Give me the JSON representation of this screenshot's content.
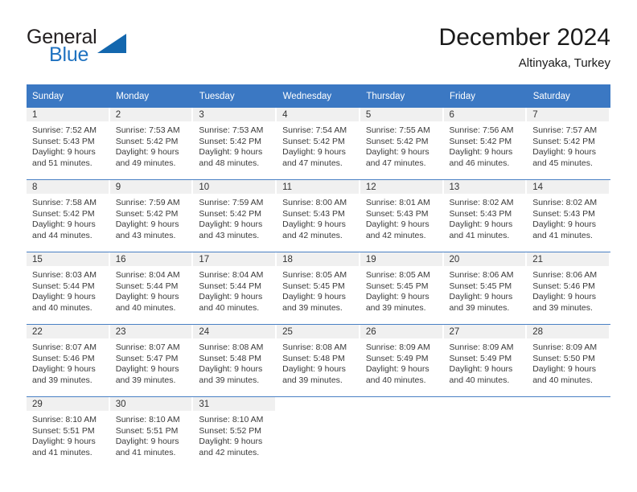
{
  "brand": {
    "name_part1": "General",
    "name_part2": "Blue",
    "triangle_color": "#1367ae",
    "blue_color": "#1f72c0"
  },
  "header": {
    "title": "December 2024",
    "location": "Altinyaka, Turkey"
  },
  "theme": {
    "header_blue": "#3b78c3",
    "row_rule_blue": "#4a80c4",
    "daynum_band": "#f0f0f0"
  },
  "weekday_headers": [
    "Sunday",
    "Monday",
    "Tuesday",
    "Wednesday",
    "Thursday",
    "Friday",
    "Saturday"
  ],
  "weeks": [
    [
      {
        "day": "1",
        "sunrise": "Sunrise: 7:52 AM",
        "sunset": "Sunset: 5:43 PM",
        "daylight1": "Daylight: 9 hours",
        "daylight2": "and 51 minutes."
      },
      {
        "day": "2",
        "sunrise": "Sunrise: 7:53 AM",
        "sunset": "Sunset: 5:42 PM",
        "daylight1": "Daylight: 9 hours",
        "daylight2": "and 49 minutes."
      },
      {
        "day": "3",
        "sunrise": "Sunrise: 7:53 AM",
        "sunset": "Sunset: 5:42 PM",
        "daylight1": "Daylight: 9 hours",
        "daylight2": "and 48 minutes."
      },
      {
        "day": "4",
        "sunrise": "Sunrise: 7:54 AM",
        "sunset": "Sunset: 5:42 PM",
        "daylight1": "Daylight: 9 hours",
        "daylight2": "and 47 minutes."
      },
      {
        "day": "5",
        "sunrise": "Sunrise: 7:55 AM",
        "sunset": "Sunset: 5:42 PM",
        "daylight1": "Daylight: 9 hours",
        "daylight2": "and 47 minutes."
      },
      {
        "day": "6",
        "sunrise": "Sunrise: 7:56 AM",
        "sunset": "Sunset: 5:42 PM",
        "daylight1": "Daylight: 9 hours",
        "daylight2": "and 46 minutes."
      },
      {
        "day": "7",
        "sunrise": "Sunrise: 7:57 AM",
        "sunset": "Sunset: 5:42 PM",
        "daylight1": "Daylight: 9 hours",
        "daylight2": "and 45 minutes."
      }
    ],
    [
      {
        "day": "8",
        "sunrise": "Sunrise: 7:58 AM",
        "sunset": "Sunset: 5:42 PM",
        "daylight1": "Daylight: 9 hours",
        "daylight2": "and 44 minutes."
      },
      {
        "day": "9",
        "sunrise": "Sunrise: 7:59 AM",
        "sunset": "Sunset: 5:42 PM",
        "daylight1": "Daylight: 9 hours",
        "daylight2": "and 43 minutes."
      },
      {
        "day": "10",
        "sunrise": "Sunrise: 7:59 AM",
        "sunset": "Sunset: 5:42 PM",
        "daylight1": "Daylight: 9 hours",
        "daylight2": "and 43 minutes."
      },
      {
        "day": "11",
        "sunrise": "Sunrise: 8:00 AM",
        "sunset": "Sunset: 5:43 PM",
        "daylight1": "Daylight: 9 hours",
        "daylight2": "and 42 minutes."
      },
      {
        "day": "12",
        "sunrise": "Sunrise: 8:01 AM",
        "sunset": "Sunset: 5:43 PM",
        "daylight1": "Daylight: 9 hours",
        "daylight2": "and 42 minutes."
      },
      {
        "day": "13",
        "sunrise": "Sunrise: 8:02 AM",
        "sunset": "Sunset: 5:43 PM",
        "daylight1": "Daylight: 9 hours",
        "daylight2": "and 41 minutes."
      },
      {
        "day": "14",
        "sunrise": "Sunrise: 8:02 AM",
        "sunset": "Sunset: 5:43 PM",
        "daylight1": "Daylight: 9 hours",
        "daylight2": "and 41 minutes."
      }
    ],
    [
      {
        "day": "15",
        "sunrise": "Sunrise: 8:03 AM",
        "sunset": "Sunset: 5:44 PM",
        "daylight1": "Daylight: 9 hours",
        "daylight2": "and 40 minutes."
      },
      {
        "day": "16",
        "sunrise": "Sunrise: 8:04 AM",
        "sunset": "Sunset: 5:44 PM",
        "daylight1": "Daylight: 9 hours",
        "daylight2": "and 40 minutes."
      },
      {
        "day": "17",
        "sunrise": "Sunrise: 8:04 AM",
        "sunset": "Sunset: 5:44 PM",
        "daylight1": "Daylight: 9 hours",
        "daylight2": "and 40 minutes."
      },
      {
        "day": "18",
        "sunrise": "Sunrise: 8:05 AM",
        "sunset": "Sunset: 5:45 PM",
        "daylight1": "Daylight: 9 hours",
        "daylight2": "and 39 minutes."
      },
      {
        "day": "19",
        "sunrise": "Sunrise: 8:05 AM",
        "sunset": "Sunset: 5:45 PM",
        "daylight1": "Daylight: 9 hours",
        "daylight2": "and 39 minutes."
      },
      {
        "day": "20",
        "sunrise": "Sunrise: 8:06 AM",
        "sunset": "Sunset: 5:45 PM",
        "daylight1": "Daylight: 9 hours",
        "daylight2": "and 39 minutes."
      },
      {
        "day": "21",
        "sunrise": "Sunrise: 8:06 AM",
        "sunset": "Sunset: 5:46 PM",
        "daylight1": "Daylight: 9 hours",
        "daylight2": "and 39 minutes."
      }
    ],
    [
      {
        "day": "22",
        "sunrise": "Sunrise: 8:07 AM",
        "sunset": "Sunset: 5:46 PM",
        "daylight1": "Daylight: 9 hours",
        "daylight2": "and 39 minutes."
      },
      {
        "day": "23",
        "sunrise": "Sunrise: 8:07 AM",
        "sunset": "Sunset: 5:47 PM",
        "daylight1": "Daylight: 9 hours",
        "daylight2": "and 39 minutes."
      },
      {
        "day": "24",
        "sunrise": "Sunrise: 8:08 AM",
        "sunset": "Sunset: 5:48 PM",
        "daylight1": "Daylight: 9 hours",
        "daylight2": "and 39 minutes."
      },
      {
        "day": "25",
        "sunrise": "Sunrise: 8:08 AM",
        "sunset": "Sunset: 5:48 PM",
        "daylight1": "Daylight: 9 hours",
        "daylight2": "and 39 minutes."
      },
      {
        "day": "26",
        "sunrise": "Sunrise: 8:09 AM",
        "sunset": "Sunset: 5:49 PM",
        "daylight1": "Daylight: 9 hours",
        "daylight2": "and 40 minutes."
      },
      {
        "day": "27",
        "sunrise": "Sunrise: 8:09 AM",
        "sunset": "Sunset: 5:49 PM",
        "daylight1": "Daylight: 9 hours",
        "daylight2": "and 40 minutes."
      },
      {
        "day": "28",
        "sunrise": "Sunrise: 8:09 AM",
        "sunset": "Sunset: 5:50 PM",
        "daylight1": "Daylight: 9 hours",
        "daylight2": "and 40 minutes."
      }
    ],
    [
      {
        "day": "29",
        "sunrise": "Sunrise: 8:10 AM",
        "sunset": "Sunset: 5:51 PM",
        "daylight1": "Daylight: 9 hours",
        "daylight2": "and 41 minutes."
      },
      {
        "day": "30",
        "sunrise": "Sunrise: 8:10 AM",
        "sunset": "Sunset: 5:51 PM",
        "daylight1": "Daylight: 9 hours",
        "daylight2": "and 41 minutes."
      },
      {
        "day": "31",
        "sunrise": "Sunrise: 8:10 AM",
        "sunset": "Sunset: 5:52 PM",
        "daylight1": "Daylight: 9 hours",
        "daylight2": "and 42 minutes."
      },
      {
        "day": "",
        "sunrise": "",
        "sunset": "",
        "daylight1": "",
        "daylight2": ""
      },
      {
        "day": "",
        "sunrise": "",
        "sunset": "",
        "daylight1": "",
        "daylight2": ""
      },
      {
        "day": "",
        "sunrise": "",
        "sunset": "",
        "daylight1": "",
        "daylight2": ""
      },
      {
        "day": "",
        "sunrise": "",
        "sunset": "",
        "daylight1": "",
        "daylight2": ""
      }
    ]
  ]
}
